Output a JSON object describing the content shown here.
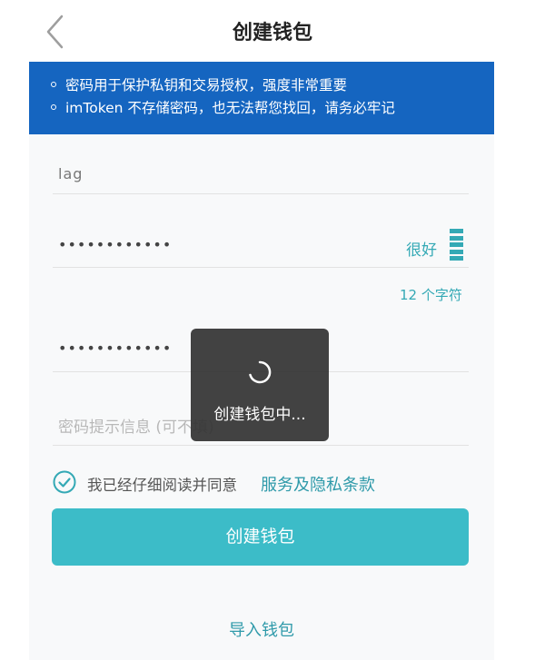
{
  "header": {
    "title": "创建钱包"
  },
  "notice": {
    "lines": [
      "密码用于保护私钥和交易授权，强度非常重要",
      "imToken 不存储密码，也无法帮您找回，请务必牢记"
    ]
  },
  "form": {
    "wallet_name": "lag",
    "password": "••••••••••••",
    "strength_label": "很好",
    "char_count": "12 个字符",
    "confirm_password": "••••••••••••",
    "hint_placeholder": "密码提示信息 (可不填)"
  },
  "agreement": {
    "text": "我已经仔细阅读并同意",
    "link": "服务及隐私条款",
    "checked": true
  },
  "create_button": "创建钱包",
  "import_link": "导入钱包",
  "toast": {
    "text": "创建钱包中..."
  },
  "colors": {
    "notice_bg": "#1565c0",
    "accent": "#34a9b5",
    "button": "#3cbcc8"
  }
}
